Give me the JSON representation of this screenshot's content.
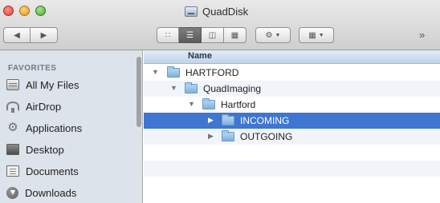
{
  "window": {
    "title": "QuadDisk"
  },
  "toolbar": {
    "back_icon": "chevron-left",
    "forward_icon": "chevron-right",
    "view_modes": [
      "icon-view",
      "list-view",
      "column-view",
      "coverflow-view"
    ],
    "active_view": "list-view",
    "action_icon": "gear-icon",
    "arrange_icon": "arrange-icon",
    "overflow_icon": "double-chevron-right"
  },
  "sidebar": {
    "heading": "FAVORITES",
    "items": [
      {
        "label": "All My Files",
        "icon": "all-my-files-icon"
      },
      {
        "label": "AirDrop",
        "icon": "airdrop-icon"
      },
      {
        "label": "Applications",
        "icon": "applications-icon"
      },
      {
        "label": "Desktop",
        "icon": "desktop-icon"
      },
      {
        "label": "Documents",
        "icon": "documents-icon"
      },
      {
        "label": "Downloads",
        "icon": "downloads-icon"
      }
    ]
  },
  "list": {
    "column_name": "Name",
    "rows": [
      {
        "label": "HARTFORD",
        "depth": 0,
        "expanded": true,
        "selected": false
      },
      {
        "label": "QuadImaging",
        "depth": 1,
        "expanded": true,
        "selected": false
      },
      {
        "label": "Hartford",
        "depth": 2,
        "expanded": true,
        "selected": false
      },
      {
        "label": "INCOMING",
        "depth": 3,
        "expanded": false,
        "selected": true
      },
      {
        "label": "OUTGOING",
        "depth": 3,
        "expanded": false,
        "selected": false
      }
    ]
  },
  "colors": {
    "selection": "#3e76d1",
    "sidebar_bg": "#dde3ea",
    "header_bg": "#cfdff0"
  }
}
